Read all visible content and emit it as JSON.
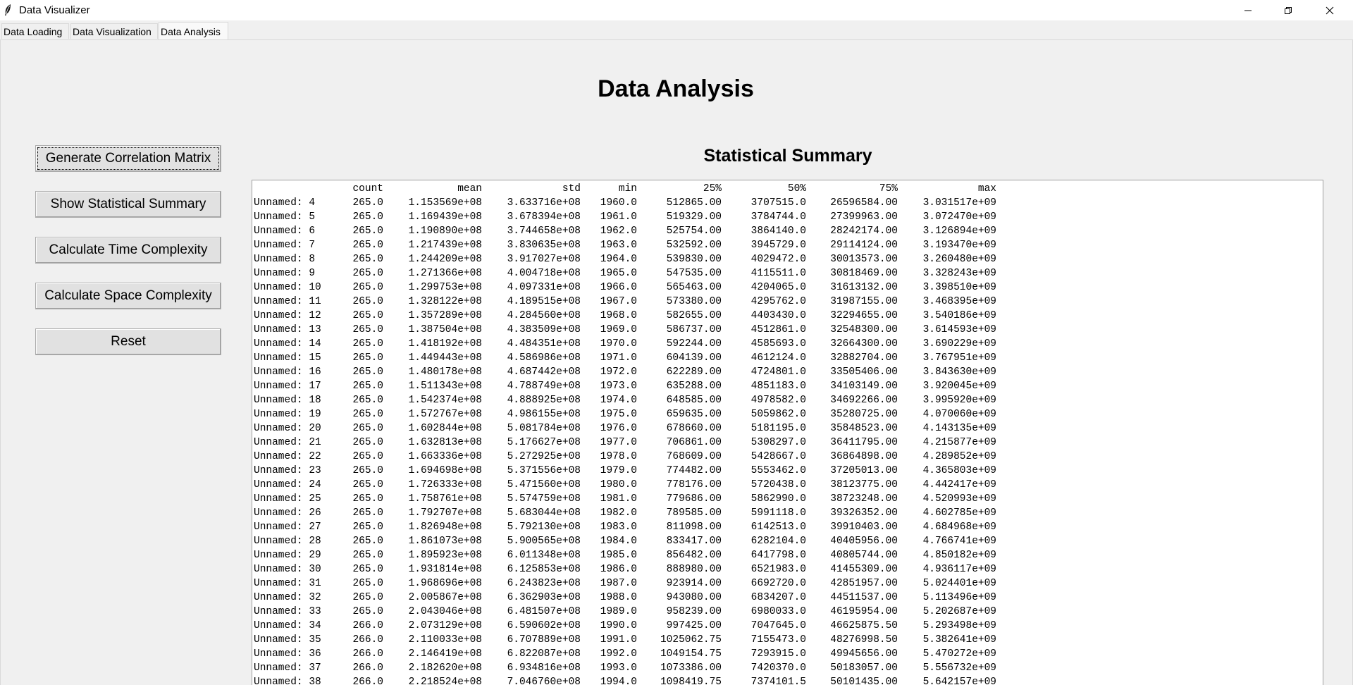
{
  "window": {
    "title": "Data Visualizer",
    "icon": "feather-icon",
    "controls": [
      "minimize-icon",
      "restore-icon",
      "close-icon"
    ]
  },
  "tabs": [
    {
      "label": "Data Loading",
      "active": false
    },
    {
      "label": "Data Visualization",
      "active": false
    },
    {
      "label": "Data Analysis",
      "active": true
    }
  ],
  "page": {
    "title": "Data Analysis"
  },
  "sidebar": {
    "buttons": [
      {
        "label": "Generate Correlation Matrix",
        "focused": true
      },
      {
        "label": "Show Statistical Summary",
        "focused": false
      },
      {
        "label": "Calculate Time Complexity",
        "focused": false
      },
      {
        "label": "Calculate Space Complexity",
        "focused": false
      },
      {
        "label": "Reset",
        "focused": false
      }
    ]
  },
  "summary": {
    "title": "Statistical Summary",
    "columns": [
      "",
      "count",
      "mean",
      "std",
      "min",
      "25%",
      "50%",
      "75%",
      "max"
    ],
    "rows": [
      [
        "Unnamed: 4",
        "265.0",
        "1.153569e+08",
        "3.633716e+08",
        "1960.0",
        "512865.00",
        "3707515.0",
        "26596584.00",
        "3.031517e+09"
      ],
      [
        "Unnamed: 5",
        "265.0",
        "1.169439e+08",
        "3.678394e+08",
        "1961.0",
        "519329.00",
        "3784744.0",
        "27399963.00",
        "3.072470e+09"
      ],
      [
        "Unnamed: 6",
        "265.0",
        "1.190890e+08",
        "3.744658e+08",
        "1962.0",
        "525754.00",
        "3864140.0",
        "28242174.00",
        "3.126894e+09"
      ],
      [
        "Unnamed: 7",
        "265.0",
        "1.217439e+08",
        "3.830635e+08",
        "1963.0",
        "532592.00",
        "3945729.0",
        "29114124.00",
        "3.193470e+09"
      ],
      [
        "Unnamed: 8",
        "265.0",
        "1.244209e+08",
        "3.917027e+08",
        "1964.0",
        "539830.00",
        "4029472.0",
        "30013573.00",
        "3.260480e+09"
      ],
      [
        "Unnamed: 9",
        "265.0",
        "1.271366e+08",
        "4.004718e+08",
        "1965.0",
        "547535.00",
        "4115511.0",
        "30818469.00",
        "3.328243e+09"
      ],
      [
        "Unnamed: 10",
        "265.0",
        "1.299753e+08",
        "4.097331e+08",
        "1966.0",
        "565463.00",
        "4204065.0",
        "31613132.00",
        "3.398510e+09"
      ],
      [
        "Unnamed: 11",
        "265.0",
        "1.328122e+08",
        "4.189515e+08",
        "1967.0",
        "573380.00",
        "4295762.0",
        "31987155.00",
        "3.468395e+09"
      ],
      [
        "Unnamed: 12",
        "265.0",
        "1.357289e+08",
        "4.284560e+08",
        "1968.0",
        "582655.00",
        "4403430.0",
        "32294655.00",
        "3.540186e+09"
      ],
      [
        "Unnamed: 13",
        "265.0",
        "1.387504e+08",
        "4.383509e+08",
        "1969.0",
        "586737.00",
        "4512861.0",
        "32548300.00",
        "3.614593e+09"
      ],
      [
        "Unnamed: 14",
        "265.0",
        "1.418192e+08",
        "4.484351e+08",
        "1970.0",
        "592244.00",
        "4585693.0",
        "32664300.00",
        "3.690229e+09"
      ],
      [
        "Unnamed: 15",
        "265.0",
        "1.449443e+08",
        "4.586986e+08",
        "1971.0",
        "604139.00",
        "4612124.0",
        "32882704.00",
        "3.767951e+09"
      ],
      [
        "Unnamed: 16",
        "265.0",
        "1.480178e+08",
        "4.687442e+08",
        "1972.0",
        "622289.00",
        "4724801.0",
        "33505406.00",
        "3.843630e+09"
      ],
      [
        "Unnamed: 17",
        "265.0",
        "1.511343e+08",
        "4.788749e+08",
        "1973.0",
        "635288.00",
        "4851183.0",
        "34103149.00",
        "3.920045e+09"
      ],
      [
        "Unnamed: 18",
        "265.0",
        "1.542374e+08",
        "4.888925e+08",
        "1974.0",
        "648585.00",
        "4978582.0",
        "34692266.00",
        "3.995920e+09"
      ],
      [
        "Unnamed: 19",
        "265.0",
        "1.572767e+08",
        "4.986155e+08",
        "1975.0",
        "659635.00",
        "5059862.0",
        "35280725.00",
        "4.070060e+09"
      ],
      [
        "Unnamed: 20",
        "265.0",
        "1.602844e+08",
        "5.081784e+08",
        "1976.0",
        "678660.00",
        "5181195.0",
        "35848523.00",
        "4.143135e+09"
      ],
      [
        "Unnamed: 21",
        "265.0",
        "1.632813e+08",
        "5.176627e+08",
        "1977.0",
        "706861.00",
        "5308297.0",
        "36411795.00",
        "4.215877e+09"
      ],
      [
        "Unnamed: 22",
        "265.0",
        "1.663336e+08",
        "5.272925e+08",
        "1978.0",
        "768609.00",
        "5428667.0",
        "36864898.00",
        "4.289852e+09"
      ],
      [
        "Unnamed: 23",
        "265.0",
        "1.694698e+08",
        "5.371556e+08",
        "1979.0",
        "774482.00",
        "5553462.0",
        "37205013.00",
        "4.365803e+09"
      ],
      [
        "Unnamed: 24",
        "265.0",
        "1.726333e+08",
        "5.471560e+08",
        "1980.0",
        "778176.00",
        "5720438.0",
        "38123775.00",
        "4.442417e+09"
      ],
      [
        "Unnamed: 25",
        "265.0",
        "1.758761e+08",
        "5.574759e+08",
        "1981.0",
        "779686.00",
        "5862990.0",
        "38723248.00",
        "4.520993e+09"
      ],
      [
        "Unnamed: 26",
        "265.0",
        "1.792707e+08",
        "5.683044e+08",
        "1982.0",
        "789585.00",
        "5991118.0",
        "39326352.00",
        "4.602785e+09"
      ],
      [
        "Unnamed: 27",
        "265.0",
        "1.826948e+08",
        "5.792130e+08",
        "1983.0",
        "811098.00",
        "6142513.0",
        "39910403.00",
        "4.684968e+09"
      ],
      [
        "Unnamed: 28",
        "265.0",
        "1.861073e+08",
        "5.900565e+08",
        "1984.0",
        "833417.00",
        "6282104.0",
        "40405956.00",
        "4.766741e+09"
      ],
      [
        "Unnamed: 29",
        "265.0",
        "1.895923e+08",
        "6.011348e+08",
        "1985.0",
        "856482.00",
        "6417798.0",
        "40805744.00",
        "4.850182e+09"
      ],
      [
        "Unnamed: 30",
        "265.0",
        "1.931814e+08",
        "6.125853e+08",
        "1986.0",
        "888980.00",
        "6521983.0",
        "41455309.00",
        "4.936117e+09"
      ],
      [
        "Unnamed: 31",
        "265.0",
        "1.968696e+08",
        "6.243823e+08",
        "1987.0",
        "923914.00",
        "6692720.0",
        "42851957.00",
        "5.024401e+09"
      ],
      [
        "Unnamed: 32",
        "265.0",
        "2.005867e+08",
        "6.362903e+08",
        "1988.0",
        "943080.00",
        "6834207.0",
        "44511537.00",
        "5.113496e+09"
      ],
      [
        "Unnamed: 33",
        "265.0",
        "2.043046e+08",
        "6.481507e+08",
        "1989.0",
        "958239.00",
        "6980033.0",
        "46195954.00",
        "5.202687e+09"
      ],
      [
        "Unnamed: 34",
        "266.0",
        "2.073129e+08",
        "6.590602e+08",
        "1990.0",
        "997425.00",
        "7047645.0",
        "46625875.50",
        "5.293498e+09"
      ],
      [
        "Unnamed: 35",
        "266.0",
        "2.110033e+08",
        "6.707889e+08",
        "1991.0",
        "1025062.75",
        "7155473.0",
        "48276998.50",
        "5.382641e+09"
      ],
      [
        "Unnamed: 36",
        "266.0",
        "2.146419e+08",
        "6.822087e+08",
        "1992.0",
        "1049154.75",
        "7293915.0",
        "49945656.00",
        "5.470272e+09"
      ],
      [
        "Unnamed: 37",
        "266.0",
        "2.182620e+08",
        "6.934816e+08",
        "1993.0",
        "1073386.00",
        "7420370.0",
        "50183057.00",
        "5.556732e+09"
      ],
      [
        "Unnamed: 38",
        "266.0",
        "2.218524e+08",
        "7.046760e+08",
        "1994.0",
        "1098419.75",
        "7374101.5",
        "50101435.00",
        "5.642157e+09"
      ]
    ]
  }
}
